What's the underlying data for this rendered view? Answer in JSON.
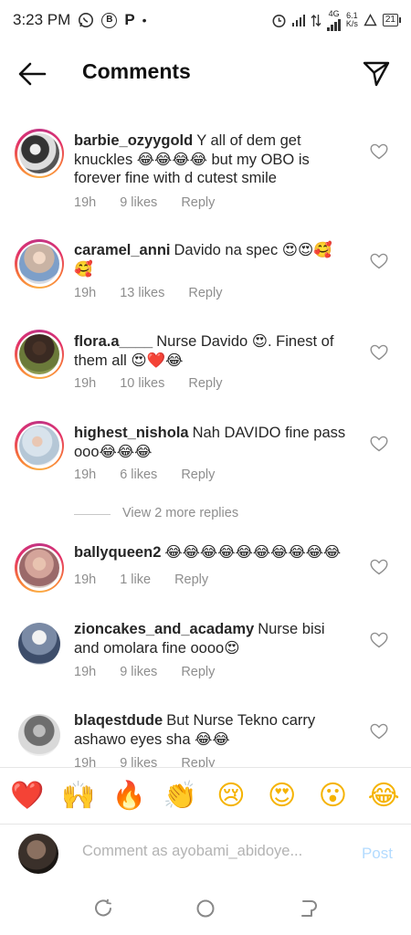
{
  "status_bar": {
    "time": "3:23 PM",
    "network_label_top": "4G",
    "speed_value": "6.1",
    "speed_unit": "K/s",
    "battery": "21"
  },
  "header": {
    "title": "Comments"
  },
  "comments": [
    {
      "username": "barbie_ozyygold",
      "text": "Y all of dem get knuckles 😂😂😂😂 but my OBO is forever fine with d cutest smile",
      "time": "19h",
      "likes": "9 likes",
      "reply": "Reply"
    },
    {
      "username": "caramel_anni",
      "text": "Davido na spec 😍😍🥰🥰",
      "time": "19h",
      "likes": "13 likes",
      "reply": "Reply"
    },
    {
      "username": "flora.a____",
      "text": "Nurse Davido 😍. Finest of them all 😍❤️😂",
      "time": "19h",
      "likes": "10 likes",
      "reply": "Reply"
    },
    {
      "username": "highest_nishola",
      "text": "Nah DAVIDO fine pass ooo😂😂😂",
      "time": "19h",
      "likes": "6 likes",
      "reply": "Reply"
    },
    {
      "username": "ballyqueen2",
      "text": "😂😂😂😂😂😂😂😂😂😂",
      "time": "19h",
      "likes": "1 like",
      "reply": "Reply"
    },
    {
      "username": "zioncakes_and_acadamy",
      "text": "Nurse bisi and omolara fine oooo😍",
      "time": "19h",
      "likes": "9 likes",
      "reply": "Reply"
    },
    {
      "username": "blaqestdude",
      "text": "But Nurse Tekno carry ashawo eyes sha 😂😂",
      "time": "19h",
      "likes": "9 likes",
      "reply": "Reply"
    }
  ],
  "view_more": "View 2 more replies",
  "emoji_bar": [
    "❤️",
    "🙌",
    "🔥",
    "👏",
    "😢",
    "😍",
    "😮",
    "😂"
  ],
  "composer": {
    "placeholder": "Comment as ayobami_abidoye...",
    "post_label": "Post"
  },
  "colors": {
    "link_blue_disabled": "#b3dbff",
    "meta_gray": "#8e8e8e",
    "story_ring": "#e1306c"
  }
}
